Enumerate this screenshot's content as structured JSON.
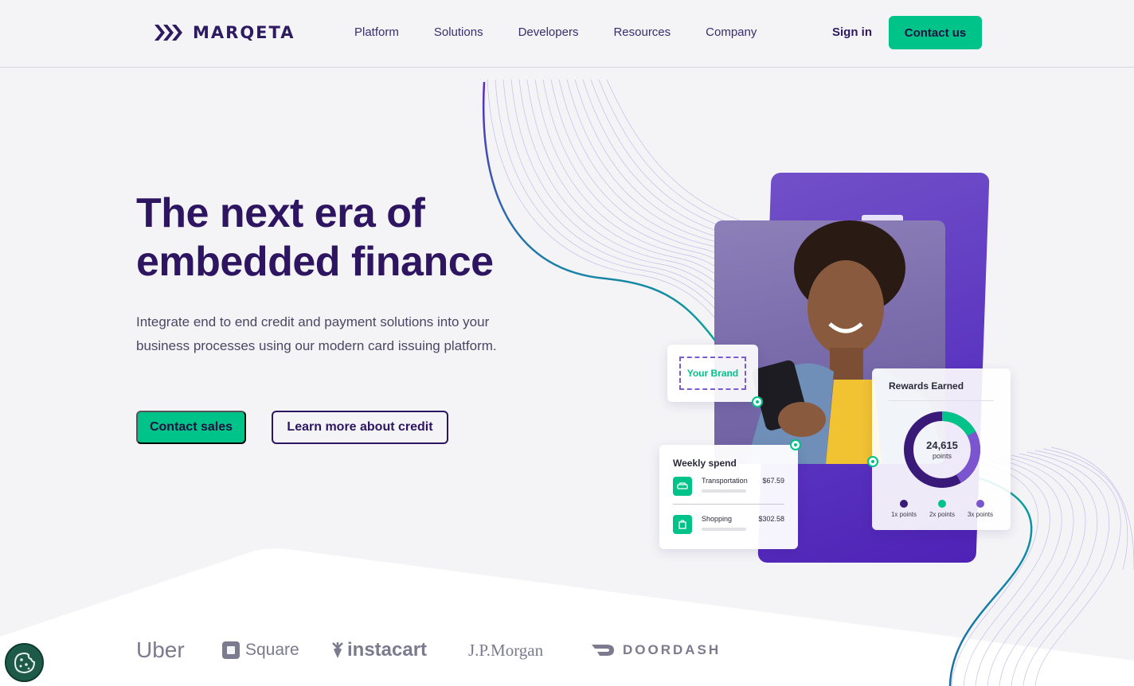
{
  "header": {
    "brand": "MARQETA",
    "nav": [
      "Platform",
      "Solutions",
      "Developers",
      "Resources",
      "Company"
    ],
    "sign_in": "Sign in",
    "contact": "Contact us"
  },
  "hero": {
    "headline_line1": "The next era of",
    "headline_line2": "embedded finance",
    "subtext": "Integrate end to end credit and payment solutions into your business processes using our modern card issuing platform.",
    "primary_cta": "Contact sales",
    "secondary_cta": "Learn more about credit"
  },
  "visual": {
    "brand_placeholder": "Your Brand",
    "weekly": {
      "title": "Weekly spend",
      "rows": [
        {
          "label": "Transportation",
          "value": "$67.59",
          "icon": "car-icon"
        },
        {
          "label": "Shopping",
          "value": "$302.58",
          "icon": "shopping-bag-icon"
        }
      ]
    },
    "rewards": {
      "title": "Rewards Earned",
      "value": "24,615",
      "unit": "points",
      "legend": [
        "1x points",
        "2x points",
        "3x points"
      ]
    }
  },
  "logos": [
    "Uber",
    "Square",
    "instacart",
    "J.P.Morgan",
    "DOORDASH"
  ],
  "colors": {
    "accent": "#00c389",
    "brand": "#2e1561",
    "purple": "#5a34c0"
  }
}
